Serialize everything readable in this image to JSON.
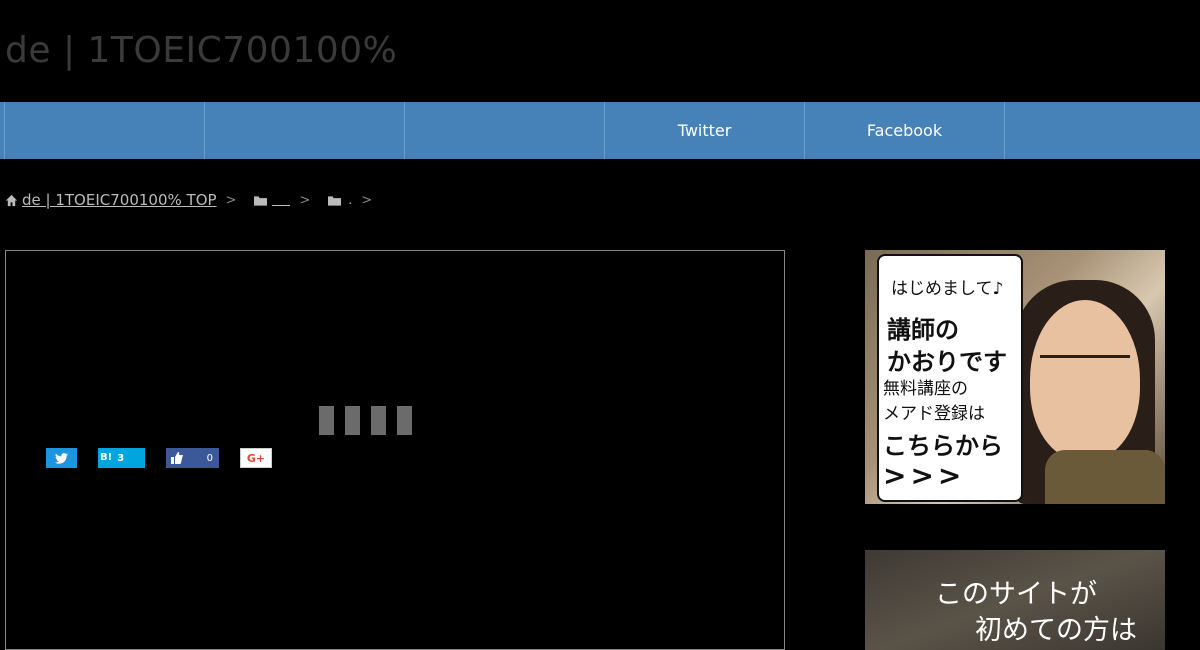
{
  "site": {
    "title": "de | 1TOEIC700100%"
  },
  "nav": {
    "items": [
      {
        "label": ""
      },
      {
        "label": ""
      },
      {
        "label": ""
      },
      {
        "label": "Twitter"
      },
      {
        "label": "Facebook"
      }
    ]
  },
  "breadcrumb": {
    "home_label": "de | 1TOEIC700100%",
    "top_label": "TOP",
    "category_1": "",
    "category_2": "."
  },
  "share": {
    "hatena_label": "B!",
    "hatena_count": "3",
    "facebook_count": "0",
    "gplus_label": "G+"
  },
  "sidebar": {
    "banner1": {
      "line1": "はじめまして♪",
      "line2": "講師の",
      "line3": "かおりです",
      "line4": "無料講座の",
      "line5": "メアド登録は",
      "line6": "こちらから",
      "line7": ">>>"
    },
    "banner2": {
      "line1": "このサイトが",
      "line2": "初めての方は"
    }
  },
  "colors": {
    "nav_bg": "#4682b8",
    "twitter": "#1b95e0",
    "hatena": "#00a4de",
    "facebook": "#3b5998",
    "gplus": "#dd4b39"
  }
}
